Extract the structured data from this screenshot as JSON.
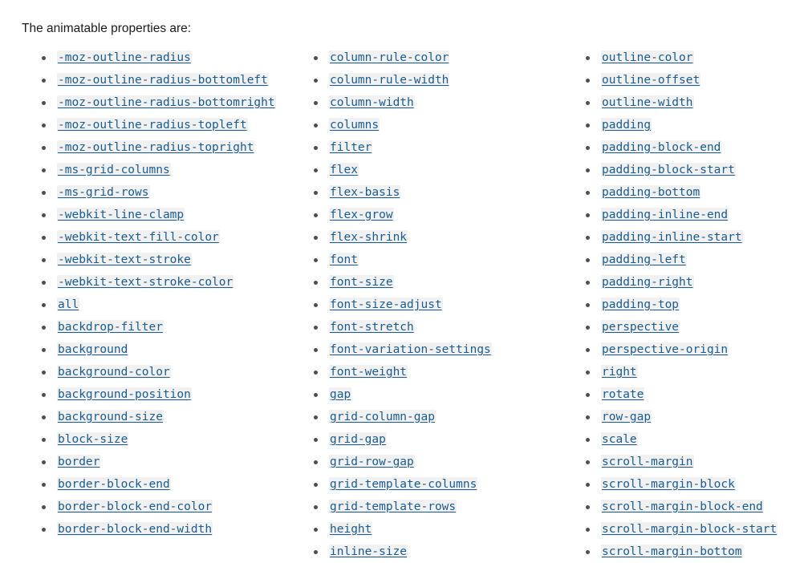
{
  "intro": {
    "text": "The animatable properties are:"
  },
  "colors": {
    "page_background": "#ffffff",
    "body_text": "#1b1b1b",
    "link_text": "#1b5c8f",
    "link_background": "#f1f1f1",
    "bullet": "#4e4e4e"
  },
  "columns": [
    {
      "id": "column-1",
      "items": [
        "-moz-outline-radius",
        "-moz-outline-radius-bottomleft",
        "-moz-outline-radius-bottomright",
        "-moz-outline-radius-topleft",
        "-moz-outline-radius-topright",
        "-ms-grid-columns",
        "-ms-grid-rows",
        "-webkit-line-clamp",
        "-webkit-text-fill-color",
        "-webkit-text-stroke",
        "-webkit-text-stroke-color",
        "all",
        "backdrop-filter",
        "background",
        "background-color",
        "background-position",
        "background-size",
        "block-size",
        "border",
        "border-block-end",
        "border-block-end-color",
        "border-block-end-width"
      ]
    },
    {
      "id": "column-2",
      "items": [
        "column-rule-color",
        "column-rule-width",
        "column-width",
        "columns",
        "filter",
        "flex",
        "flex-basis",
        "flex-grow",
        "flex-shrink",
        "font",
        "font-size",
        "font-size-adjust",
        "font-stretch",
        "font-variation-settings",
        "font-weight",
        "gap",
        "grid-column-gap",
        "grid-gap",
        "grid-row-gap",
        "grid-template-columns",
        "grid-template-rows",
        "height",
        "inline-size"
      ]
    },
    {
      "id": "column-3",
      "items": [
        "outline-color",
        "outline-offset",
        "outline-width",
        "padding",
        "padding-block-end",
        "padding-block-start",
        "padding-bottom",
        "padding-inline-end",
        "padding-inline-start",
        "padding-left",
        "padding-right",
        "padding-top",
        "perspective",
        "perspective-origin",
        "right",
        "rotate",
        "row-gap",
        "scale",
        "scroll-margin",
        "scroll-margin-block",
        "scroll-margin-block-end",
        "scroll-margin-block-start",
        "scroll-margin-bottom"
      ]
    }
  ]
}
